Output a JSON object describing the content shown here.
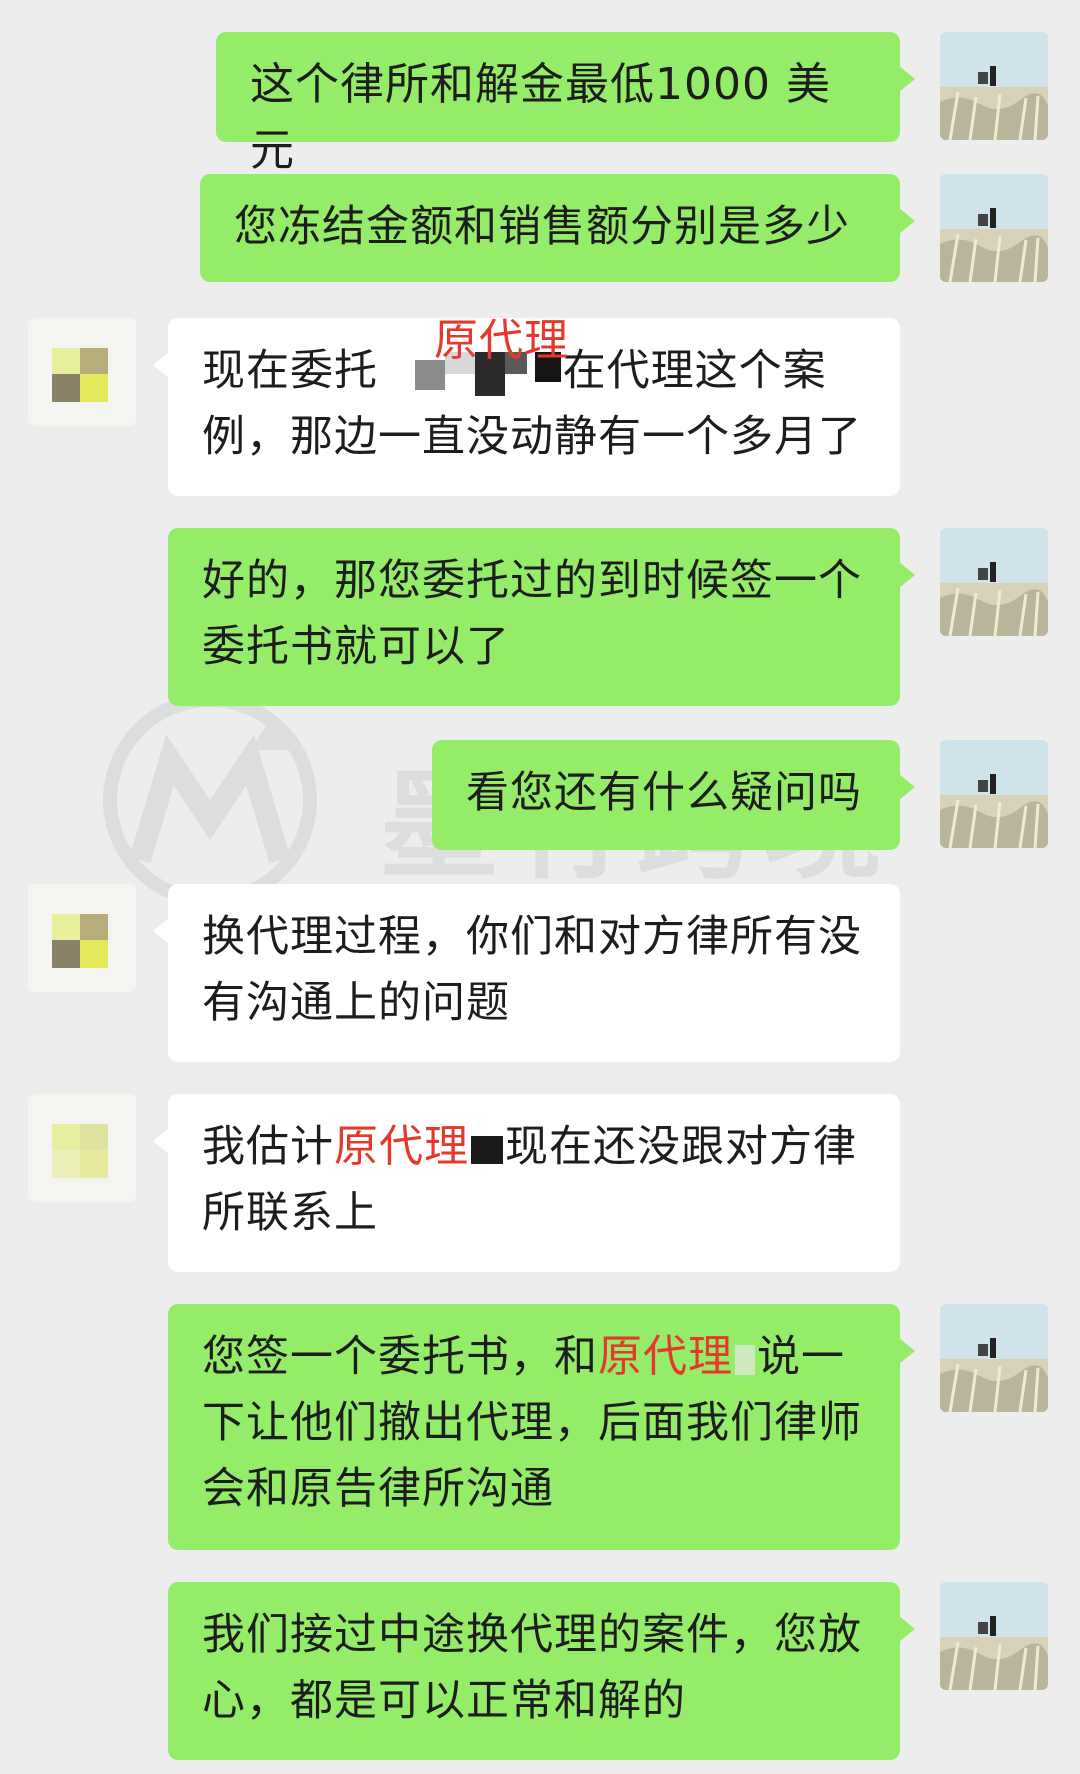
{
  "messages": [
    {
      "side": "right",
      "text": "这个律所和解金最低1000 美元"
    },
    {
      "side": "right",
      "text": "您冻结金额和销售额分别是多少"
    },
    {
      "side": "left",
      "line1_before": "现在委托",
      "label": "原代理",
      "line1_after": "在代理这个案",
      "line2": "例，那边一直没动静有一个多月了"
    },
    {
      "side": "right",
      "line1": "好的，那您委托过的到时候签一个",
      "line2": "委托书就可以了"
    },
    {
      "side": "right",
      "text": "看您还有什么疑问吗"
    },
    {
      "side": "left",
      "line1": "换代理过程，你们和对方律所有没",
      "line2": "有沟通上的问题"
    },
    {
      "side": "left",
      "line1_before": "我估计",
      "label": "原代理",
      "line1_after": "现在还没跟对方律",
      "line2": "所联系上"
    },
    {
      "side": "right",
      "line1_before": "您签一个委托书，和",
      "label": "原代理",
      "line1_after": "说一",
      "line2": "下让他们撤出代理，后面我们律师",
      "line3": "会和原告律所沟通"
    },
    {
      "side": "right",
      "line1": "我们接过中途换代理的案件，您放",
      "line2": "心，都是可以正常和解的"
    }
  ],
  "colors": {
    "sent_bubble": "#95ec69",
    "received_bubble": "#ffffff",
    "background": "#ededed",
    "annotation_red": "#e5392b"
  },
  "watermark": {
    "text": "墨竹跨境"
  },
  "icons": {
    "self_avatar": "landscape-photo-avatar",
    "contact_avatar": "pixelated-avatar"
  }
}
